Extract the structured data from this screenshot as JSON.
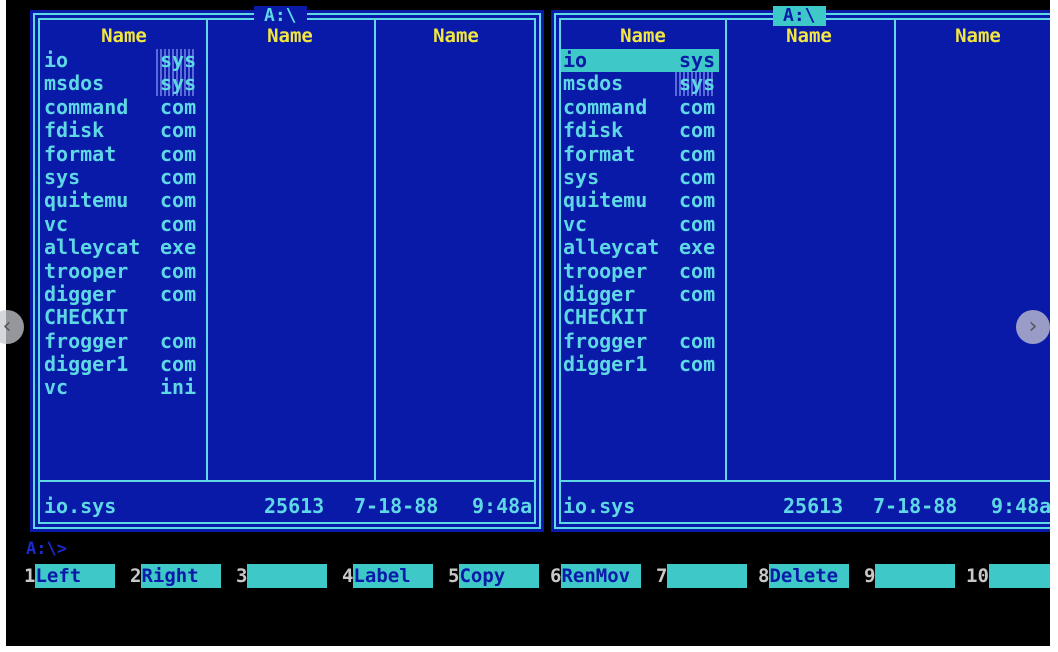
{
  "left_panel": {
    "path": "A:\\",
    "headers": [
      "Name",
      "Name",
      "Name"
    ],
    "files": [
      {
        "name": "io",
        "ext": "sys",
        "hidden": true
      },
      {
        "name": "msdos",
        "ext": "sys",
        "hidden": true
      },
      {
        "name": "command",
        "ext": "com"
      },
      {
        "name": "fdisk",
        "ext": "com"
      },
      {
        "name": "format",
        "ext": "com"
      },
      {
        "name": "sys",
        "ext": "com"
      },
      {
        "name": "quitemu",
        "ext": "com"
      },
      {
        "name": "vc",
        "ext": "com"
      },
      {
        "name": "alleycat",
        "ext": "exe"
      },
      {
        "name": "trooper",
        "ext": "com"
      },
      {
        "name": "digger",
        "ext": "com"
      },
      {
        "name": "CHECKIT",
        "ext": ""
      },
      {
        "name": "frogger",
        "ext": "com"
      },
      {
        "name": "digger1",
        "ext": "com"
      },
      {
        "name": "vc",
        "ext": "ini"
      }
    ],
    "status": {
      "file": "io.sys",
      "size": "25613",
      "date": "7-18-88",
      "time": "9:48a"
    }
  },
  "right_panel": {
    "path": "A:\\",
    "headers": [
      "Name",
      "Name",
      "Name"
    ],
    "files": [
      {
        "name": "io",
        "ext": "sys",
        "hidden": true,
        "selected": true
      },
      {
        "name": "msdos",
        "ext": "sys",
        "hidden": true
      },
      {
        "name": "command",
        "ext": "com"
      },
      {
        "name": "fdisk",
        "ext": "com"
      },
      {
        "name": "format",
        "ext": "com"
      },
      {
        "name": "sys",
        "ext": "com"
      },
      {
        "name": "quitemu",
        "ext": "com"
      },
      {
        "name": "vc",
        "ext": "com"
      },
      {
        "name": "alleycat",
        "ext": "exe"
      },
      {
        "name": "trooper",
        "ext": "com"
      },
      {
        "name": "digger",
        "ext": "com"
      },
      {
        "name": "CHECKIT",
        "ext": ""
      },
      {
        "name": "frogger",
        "ext": "com"
      },
      {
        "name": "digger1",
        "ext": "com"
      }
    ],
    "status": {
      "file": "io.sys",
      "size": "25613",
      "date": "7-18-88",
      "time": "9:48a"
    }
  },
  "command_line": "A:\\>",
  "function_keys": [
    {
      "num": "1",
      "label": "Left"
    },
    {
      "num": "2",
      "label": "Right"
    },
    {
      "num": "3",
      "label": ""
    },
    {
      "num": "4",
      "label": "Label"
    },
    {
      "num": "5",
      "label": "Copy"
    },
    {
      "num": "6",
      "label": "RenMov"
    },
    {
      "num": "7",
      "label": ""
    },
    {
      "num": "8",
      "label": "Delete"
    },
    {
      "num": "9",
      "label": ""
    },
    {
      "num": "10",
      "label": ""
    }
  ],
  "icons": {
    "prev": "chevron-left-icon",
    "next": "chevron-right-icon"
  },
  "colors": {
    "panel_bg": "#0a1aa8",
    "frame": "#5fd8e6",
    "header": "#f2e640",
    "highlight": "#3fc8c8"
  }
}
